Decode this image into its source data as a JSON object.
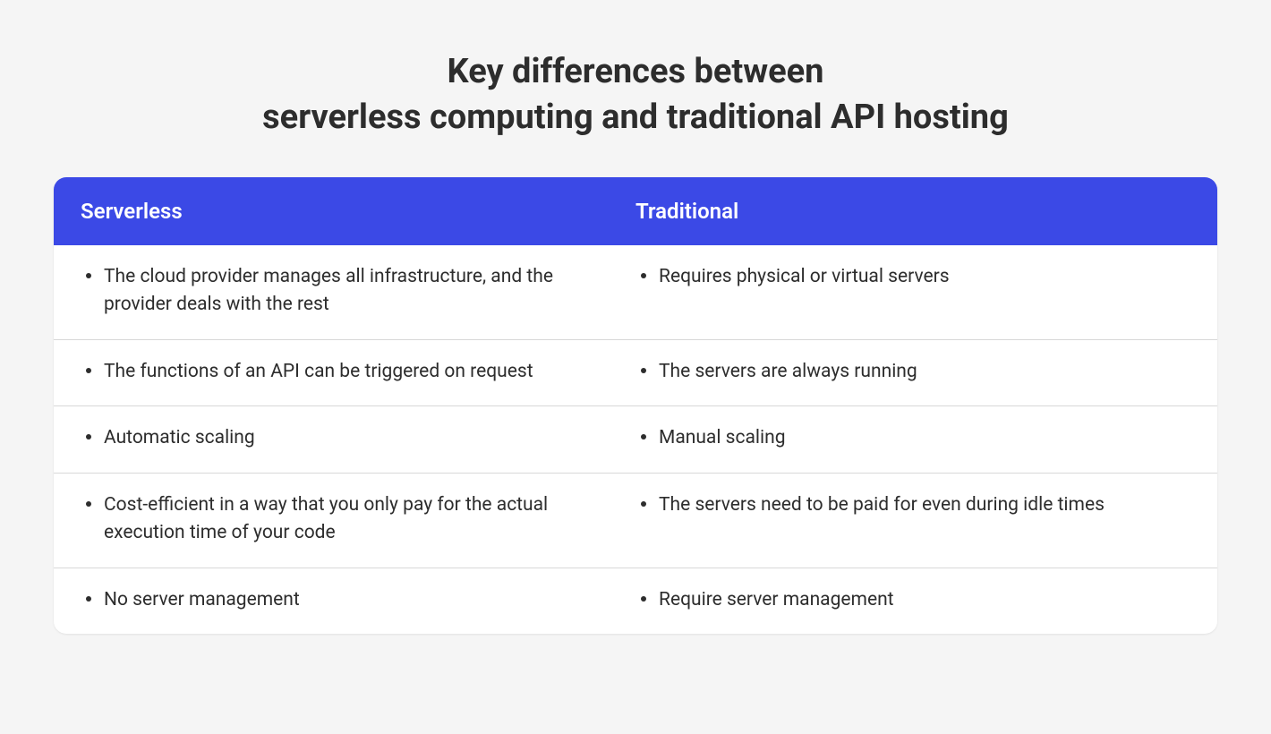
{
  "title_line1": "Key differences between",
  "title_line2": "serverless computing and traditional API hosting",
  "table": {
    "headers": {
      "left": "Serverless",
      "right": "Traditional"
    },
    "rows": [
      {
        "left": "The cloud provider manages all infrastructure, and the provider deals with the rest",
        "right": "Requires physical or virtual servers"
      },
      {
        "left": "The functions of an API can be triggered on request",
        "right": "The servers are always running"
      },
      {
        "left": "Automatic scaling",
        "right": "Manual scaling"
      },
      {
        "left": "Cost-efficient in a way that you only pay for the actual execution time of your code",
        "right": "The servers need to be paid for even during idle times"
      },
      {
        "left": "No server management",
        "right": "Require server management"
      }
    ]
  }
}
